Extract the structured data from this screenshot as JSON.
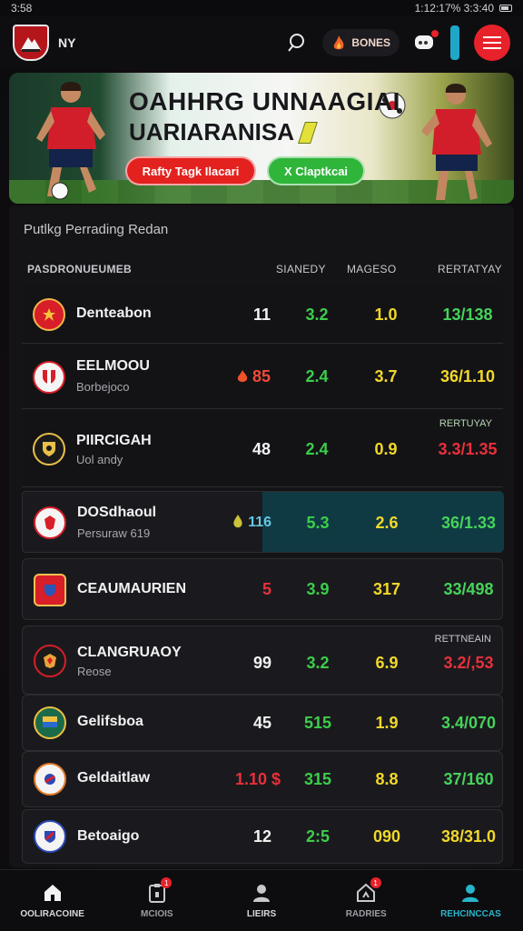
{
  "status": {
    "left": "3:58",
    "right": "1:12:17% 3:3:40"
  },
  "header": {
    "logo_text": "NY",
    "bonus_label": "BONES"
  },
  "banner": {
    "title": "OAHHRG UNNAAGIAI",
    "subtitle": "UARIARANISA",
    "primary_cta": "Rafty Tagk Ilacari",
    "secondary_cta": "X Claptkcai"
  },
  "panel": {
    "title": "Putlkg Perrading Redan",
    "columns": {
      "team": "PASDRONUEUMEB",
      "c1": "SIANEDY",
      "c2": "MAGESO",
      "c3": "RERTATYAY"
    }
  },
  "rows": [
    {
      "name": "Denteabon",
      "sub": "",
      "v0": "11",
      "v1": "3.2",
      "v2": "1.0",
      "v3": "13/138",
      "label": ""
    },
    {
      "name": "EELMOOU",
      "sub": "Borbejoco",
      "v0": "85",
      "v1": "2.4",
      "v2": "3.7",
      "v3": "36/1.10",
      "label": ""
    },
    {
      "name": "PIIRCIGAH",
      "sub": "Uol andy",
      "v0": "48",
      "v1": "2.4",
      "v2": "0.9",
      "v3": "3.3/1.35",
      "label": "RERTUYAY"
    },
    {
      "name": "DOSdhaoul",
      "sub": "Persuraw 619",
      "v0": "116",
      "v1": "5.3",
      "v2": "2.6",
      "v3": "36/1.33",
      "label": ""
    },
    {
      "name": "CEAUMAURIEN",
      "sub": "",
      "v0": "5",
      "v1": "3.9",
      "v2": "317",
      "v3": "33/498",
      "label": ""
    },
    {
      "name": "CLANGRUAOY",
      "sub": "Reose",
      "v0": "99",
      "v1": "3.2",
      "v2": "6.9",
      "v3": "3.2/,53",
      "label": "RETTNEAIN"
    },
    {
      "name": "Gelifsboa",
      "sub": "",
      "v0": "45",
      "v1": "515",
      "v2": "1.9",
      "v3": "3.4/070",
      "label": ""
    },
    {
      "name": "Geldaitlaw",
      "sub": "",
      "v0": "1.10 $",
      "v1": "315",
      "v2": "8.8",
      "v3": "37/160",
      "label": ""
    },
    {
      "name": "Betoaigo",
      "sub": "",
      "v0": "12",
      "v1": "2:5",
      "v2": "090",
      "v3": "38/31.0",
      "label": ""
    }
  ],
  "tabs": [
    {
      "label": "OOLIRACOINE",
      "icon": "home-icon"
    },
    {
      "label": "MCIOIS",
      "icon": "clipboard-icon",
      "badge": "1"
    },
    {
      "label": "LIEIRS",
      "icon": "user-icon"
    },
    {
      "label": "RADRIES",
      "icon": "house-share-icon",
      "badge": "1"
    },
    {
      "label": "REHCINCCAS",
      "icon": "profile-icon"
    }
  ],
  "colors": {
    "accent": "#e8222a",
    "teal": "#27b5c9",
    "green": "#3ccd4a",
    "yellow": "#f2d829"
  }
}
